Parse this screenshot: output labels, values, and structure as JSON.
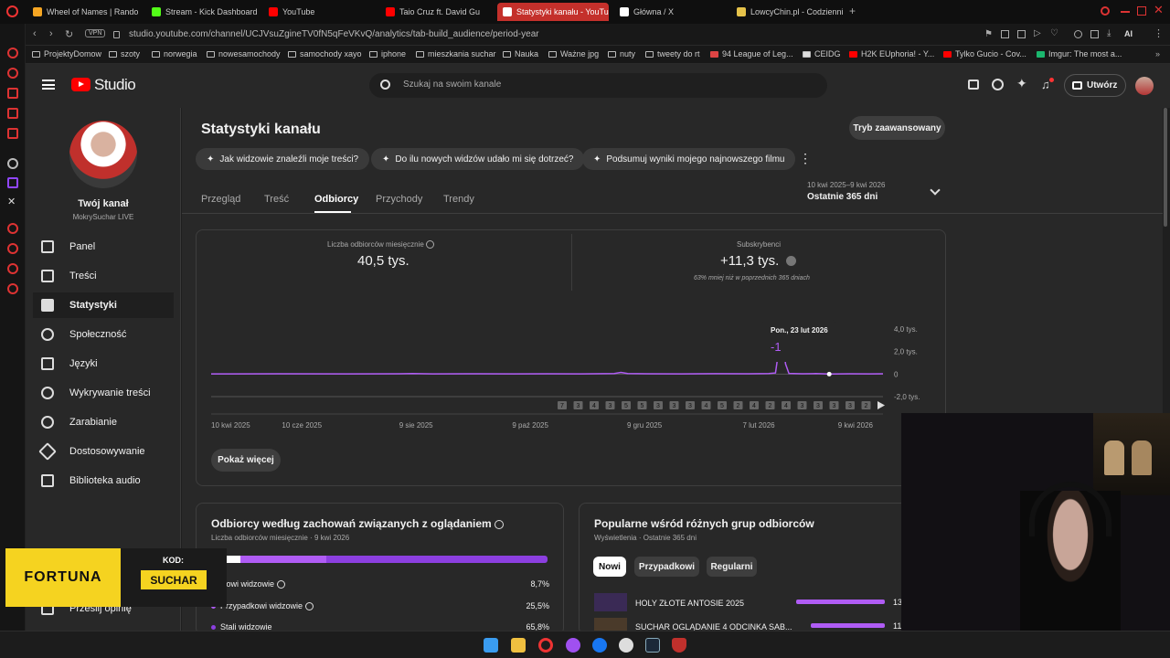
{
  "browser": {
    "tabs": [
      {
        "label": "Wheel of Names | Random",
        "color": "#f6a623"
      },
      {
        "label": "Stream - Kick Dashboard",
        "color": "#53fc18"
      },
      {
        "label": "YouTube",
        "color": "#ff0000"
      },
      {
        "label": "Taio Cruz ft. David Gu",
        "color": "#ff0000"
      },
      {
        "label": "Statystyki kanału - YouTu",
        "color": "#ff4e45"
      },
      {
        "label": "Główna / X",
        "color": "#ffffff"
      },
      {
        "label": "LowcyChin.pl - Codzienni",
        "color": "#e5c24a"
      }
    ],
    "new_tab": "+",
    "vpn": "VPN",
    "url": "studio.youtube.com/channel/UCJVsuZgineTV0fN5qFeVKvQ/analytics/tab-build_audience/period-year",
    "bookmarks": [
      "ProjektyDomow",
      "szoty",
      "norwegia",
      "nowesamochody",
      "samochody xayo",
      "iphone",
      "mieszkania suchar",
      "Nauka",
      "Ważne jpg",
      "nuty",
      "tweety do rt",
      "94 League of Leg...",
      "CEIDG",
      "H2K EUphoria! - Y...",
      "Tylko Gucio - Cov...",
      "Imgur: The most a..."
    ],
    "ai_label": "AI"
  },
  "studio": {
    "logo": "Studio",
    "search_placeholder": "Szukaj na swoim kanale",
    "create_label": "Utwórz"
  },
  "sidebar": {
    "channel_title": "Twój kanał",
    "channel_name": "MokrySuchar LIVE",
    "items": [
      {
        "label": "Panel",
        "icon": "dashboard-icon"
      },
      {
        "label": "Treści",
        "icon": "content-icon"
      },
      {
        "label": "Statystyki",
        "icon": "analytics-icon"
      },
      {
        "label": "Społeczność",
        "icon": "community-icon"
      },
      {
        "label": "Języki",
        "icon": "subtitles-icon"
      },
      {
        "label": "Wykrywanie treści",
        "icon": "copyright-icon"
      },
      {
        "label": "Zarabianie",
        "icon": "monetization-icon"
      },
      {
        "label": "Dostosowywanie",
        "icon": "customization-icon"
      },
      {
        "label": "Biblioteka audio",
        "icon": "audio-library-icon"
      }
    ],
    "feedback": "Prześlij opinię"
  },
  "page": {
    "title": "Statystyki kanału",
    "advanced": "Tryb zaawansowany",
    "chips": [
      "Jak widzowie znaleźli moje treści?",
      "Do ilu nowych widzów udało mi się dotrzeć?",
      "Podsumuj wyniki mojego najnowszego filmu"
    ],
    "tabs": [
      "Przegląd",
      "Treść",
      "Odbiorcy",
      "Przychody",
      "Trendy"
    ],
    "active_tab": "Odbiorcy",
    "date_range": "10 kwi 2025–9 kwi 2026",
    "period": "Ostatnie 365 dni"
  },
  "metrics": {
    "monthly_label": "Liczba odbiorców miesięcznie",
    "monthly_value": "40,5 tys.",
    "subs_label": "Subskrybenci",
    "subs_value": "+11,3 tys.",
    "subs_note": "63% mniej niż w poprzednich 365 dniach"
  },
  "chart_data": {
    "type": "line",
    "x_ticks": [
      "10 kwi 2025",
      "10 cze 2025",
      "9 sie 2025",
      "9 paź 2025",
      "9 gru 2025",
      "7 lut 2026",
      "9 kwi 2026"
    ],
    "y_ticks": [
      "4,0 tys.",
      "2,0 tys.",
      "0",
      "-2,0 tys."
    ],
    "ylim": [
      -2000,
      4000
    ],
    "series": [
      {
        "color": "#b05cf5",
        "points": [
          [
            0,
            20
          ],
          [
            0.1,
            30
          ],
          [
            0.2,
            15
          ],
          [
            0.28,
            25
          ],
          [
            0.3,
            40
          ],
          [
            0.33,
            20
          ],
          [
            0.4,
            30
          ],
          [
            0.45,
            18
          ],
          [
            0.5,
            25
          ],
          [
            0.55,
            20
          ],
          [
            0.6,
            40
          ],
          [
            0.61,
            150
          ],
          [
            0.62,
            40
          ],
          [
            0.65,
            30
          ],
          [
            0.7,
            20
          ],
          [
            0.75,
            35
          ],
          [
            0.8,
            25
          ],
          [
            0.83,
            40
          ],
          [
            0.84,
            100
          ],
          [
            0.845,
            2200
          ],
          [
            0.85,
            3300
          ],
          [
            0.855,
            900
          ],
          [
            0.86,
            60
          ],
          [
            0.88,
            30
          ],
          [
            0.9,
            40
          ],
          [
            0.92,
            -1
          ],
          [
            0.95,
            30
          ],
          [
            0.98,
            20
          ],
          [
            1,
            25
          ]
        ]
      }
    ],
    "tooltip": {
      "date": "Pon., 23 lut 2026",
      "value": "-1",
      "x": 0.92
    },
    "markers": [
      "7",
      "3",
      "4",
      "3",
      "5",
      "5",
      "3",
      "3",
      "3",
      "4",
      "5",
      "2",
      "4",
      "2",
      "4",
      "3",
      "3",
      "3",
      "3",
      "2"
    ]
  },
  "show_more": "Pokaż więcej",
  "behavior": {
    "title": "Odbiorcy według zachowań związanych z oglądaniem",
    "subtitle": "Liczba odbiorców miesięcznie · 9 kwi 2026",
    "rows": [
      {
        "label": "Nowi widzowie",
        "value": "8,7%",
        "color": "#ffffff"
      },
      {
        "label": "Przypadkowi widzowie",
        "value": "25,5%",
        "color": "#b05cf5"
      },
      {
        "label": "Stali widzowie",
        "value": "65,8%",
        "color": "#7a3cc4"
      }
    ]
  },
  "popular": {
    "title": "Popularne wśród różnych grup odbiorców",
    "subtitle": "Wyświetlenia · Ostatnie 365 dni",
    "pills": [
      "Nowi",
      "Przypadkowi",
      "Regularni"
    ],
    "videos": [
      {
        "title": "HOLY ZŁOTE ANTOSIE 2025",
        "value": "13",
        "fill": 0.95
      },
      {
        "title": "SUCHAR OGLĄDANIE 4 ODCINKA SAB...",
        "value": "11",
        "fill": 0.8
      }
    ]
  },
  "promo": {
    "brand": "FORTUNA",
    "code_label": "KOD:",
    "code": "SUCHAR"
  }
}
